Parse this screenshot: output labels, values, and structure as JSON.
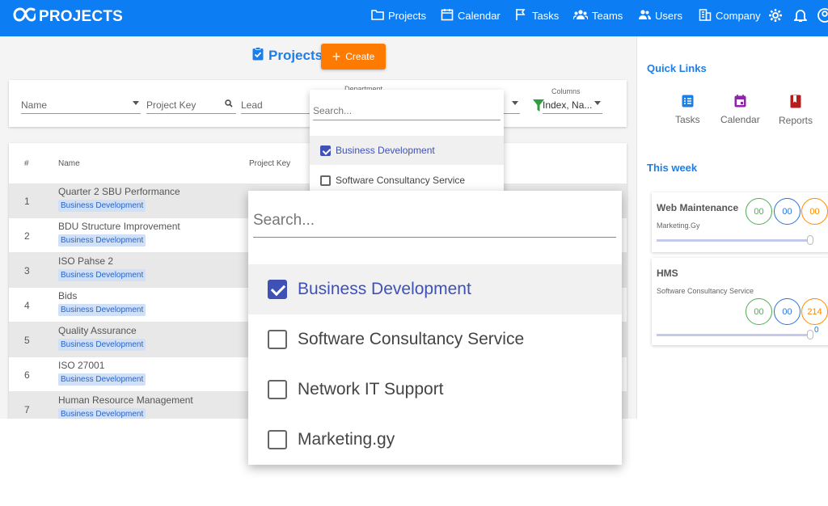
{
  "app": {
    "brand": "PROJECTS",
    "accent": "#0d7df3"
  },
  "nav": [
    {
      "label": "Projects",
      "icon": "folder-icon"
    },
    {
      "label": "Calendar",
      "icon": "calendar-icon"
    },
    {
      "label": "Tasks",
      "icon": "tasks-icon"
    },
    {
      "label": "Teams",
      "icon": "teams-icon"
    },
    {
      "label": "Users",
      "icon": "users-icon"
    },
    {
      "label": "Company",
      "icon": "company-icon"
    }
  ],
  "header": {
    "title": "Projects",
    "create_label": "Create"
  },
  "filters": {
    "name_placeholder": "Name",
    "project_key_placeholder": "Project Key",
    "lead_placeholder": "Lead",
    "department_label": "Department",
    "columns_label": "Columns",
    "columns_value": "Index, Na..."
  },
  "table": {
    "headers": {
      "index": "#",
      "name": "Name",
      "project_key": "Project Key"
    },
    "rows": [
      {
        "num": "1",
        "name": "Quarter 2 SBU Performance",
        "dept": "Business Development"
      },
      {
        "num": "2",
        "name": "BDU Structure Improvement",
        "dept": "Business Development"
      },
      {
        "num": "3",
        "name": "ISO Pahse 2",
        "dept": "Business Development"
      },
      {
        "num": "4",
        "name": "Bids",
        "dept": "Business Development"
      },
      {
        "num": "5",
        "name": "Quality Assurance",
        "dept": "Business Development"
      },
      {
        "num": "6",
        "name": "ISO 27001",
        "dept": "Business Development"
      },
      {
        "num": "7",
        "name": "Human Resource Management",
        "dept": "Business Development"
      }
    ]
  },
  "department_dropdown": {
    "search_placeholder": "Search...",
    "options": [
      {
        "label": "Business Development",
        "checked": true
      },
      {
        "label": "Software Consultancy Service",
        "checked": false
      },
      {
        "label": "Network IT Support",
        "checked": false
      },
      {
        "label": "Marketing.gy",
        "checked": false
      }
    ]
  },
  "sidebar": {
    "quick_links_title": "Quick Links",
    "quick_links": [
      {
        "label": "Tasks",
        "icon": "tasks-icon",
        "color": "#1e7ee8"
      },
      {
        "label": "Calendar",
        "icon": "calendar-icon",
        "color": "#8e24aa"
      },
      {
        "label": "Reports",
        "icon": "book-icon",
        "color": "#b71c1c"
      }
    ],
    "this_week_title": "This week",
    "week_items": [
      {
        "title": "Web Maintenance",
        "department": "Marketing.Gy",
        "counts": [
          "00",
          "00",
          "00"
        ],
        "progress": 1.0
      },
      {
        "title": "HMS",
        "department": "Software Consultancy Service",
        "counts": [
          "00",
          "00",
          "214"
        ],
        "progress": 1.0,
        "progress_label": "0"
      }
    ]
  }
}
